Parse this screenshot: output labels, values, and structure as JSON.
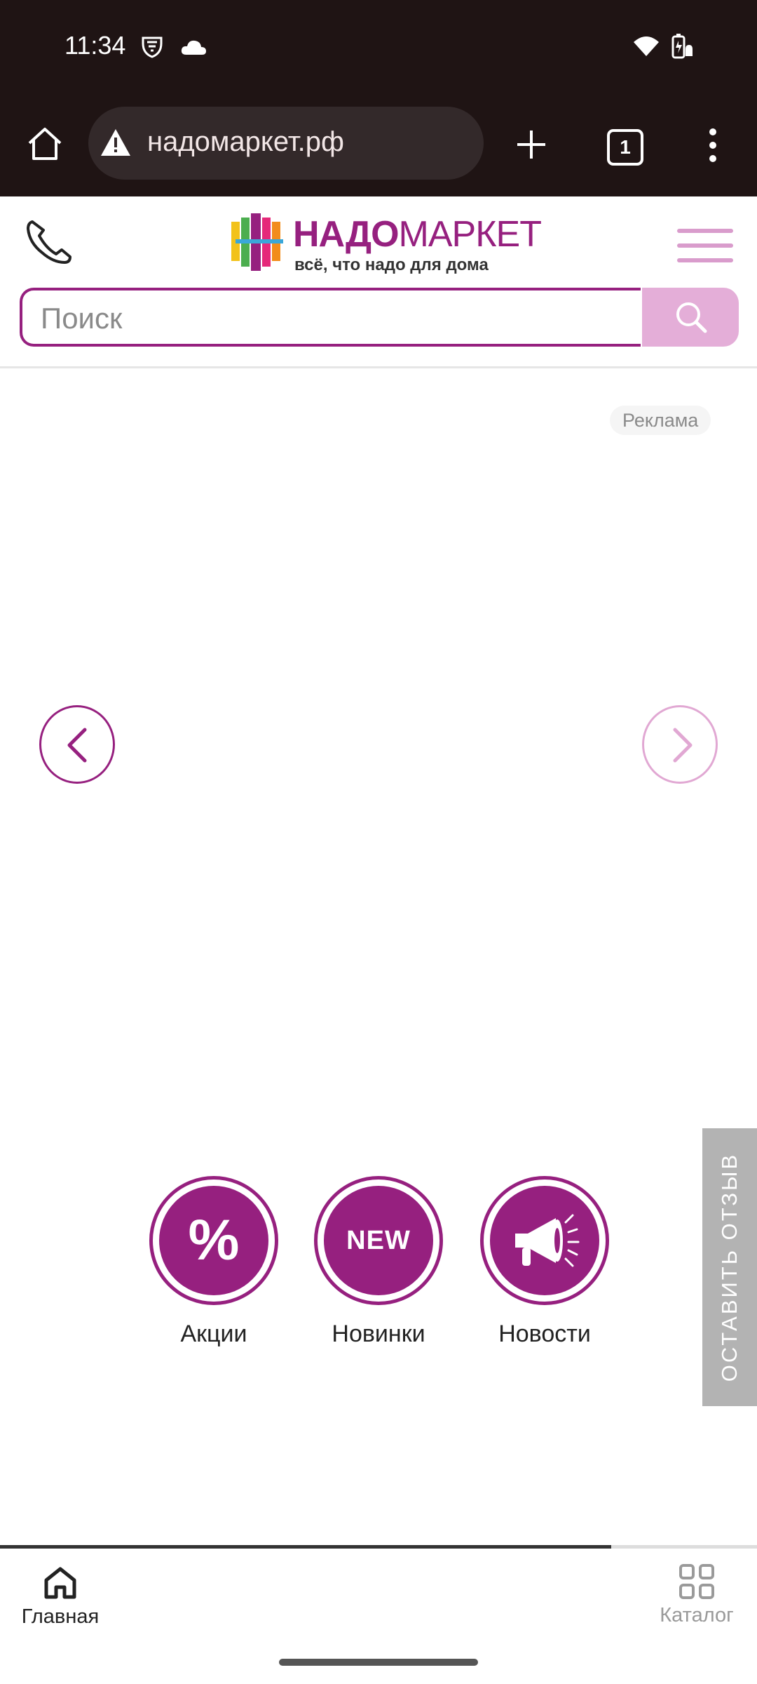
{
  "status_bar": {
    "time": "11:34"
  },
  "browser": {
    "url": "надомаркет.рф",
    "tab_count": "1"
  },
  "site": {
    "logo_bold": "НАДО",
    "logo_light": "МАРКЕТ",
    "tagline": "всё, что надо для дома",
    "search_placeholder": "Поиск"
  },
  "banner": {
    "ad_label": "Реклама"
  },
  "feedback": {
    "label": "ОСТАВИТЬ ОТЗЫВ"
  },
  "quick_links": [
    {
      "label": "Акции",
      "icon": "percent-icon",
      "glyph": "%"
    },
    {
      "label": "Новинки",
      "icon": "new-badge-icon",
      "glyph": "NEW"
    },
    {
      "label": "Новости",
      "icon": "megaphone-icon"
    }
  ],
  "bottom_nav": [
    {
      "label": "Главная",
      "icon": "home-icon"
    },
    {
      "label": "Каталог",
      "icon": "catalog-grid-icon"
    }
  ],
  "colors": {
    "brand": "#96207f",
    "brand_light": "#e4aed8",
    "browser_bg": "#1f1414"
  }
}
